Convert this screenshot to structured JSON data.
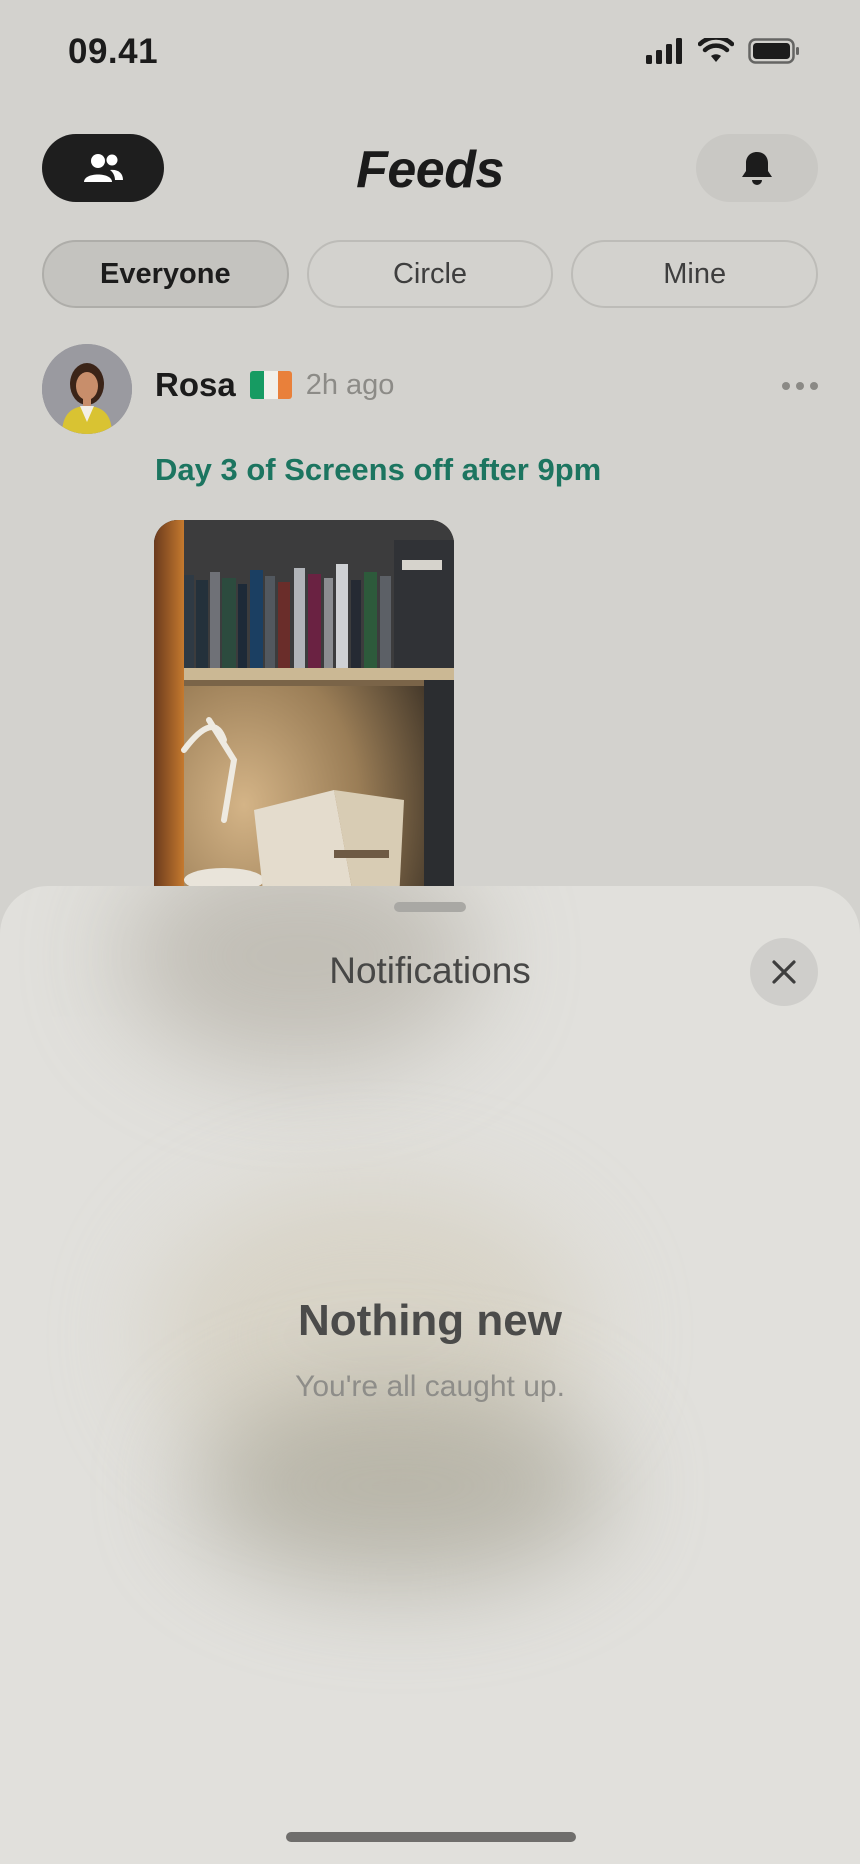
{
  "status_bar": {
    "time": "09.41",
    "icons": [
      "signal-icon",
      "wifi-icon",
      "battery-icon"
    ]
  },
  "header": {
    "title": "Feeds",
    "left_icon": "people-icon",
    "right_icon": "bell-icon"
  },
  "tabs": [
    {
      "label": "Everyone",
      "active": true
    },
    {
      "label": "Circle",
      "active": false
    },
    {
      "label": "Mine",
      "active": false
    }
  ],
  "post": {
    "author": "Rosa",
    "flag": "ireland-flag",
    "time": "2h ago",
    "caption": "Day 3 of Screens off after 9pm",
    "accent_color": "#1c7560"
  },
  "sheet": {
    "title": "Notifications",
    "empty_title": "Nothing new",
    "empty_subtitle": "You're all caught up."
  },
  "colors": {
    "background": "#d3d2ce",
    "sheet": "#e1e0dc",
    "primary_dark": "#1e1e1e"
  }
}
